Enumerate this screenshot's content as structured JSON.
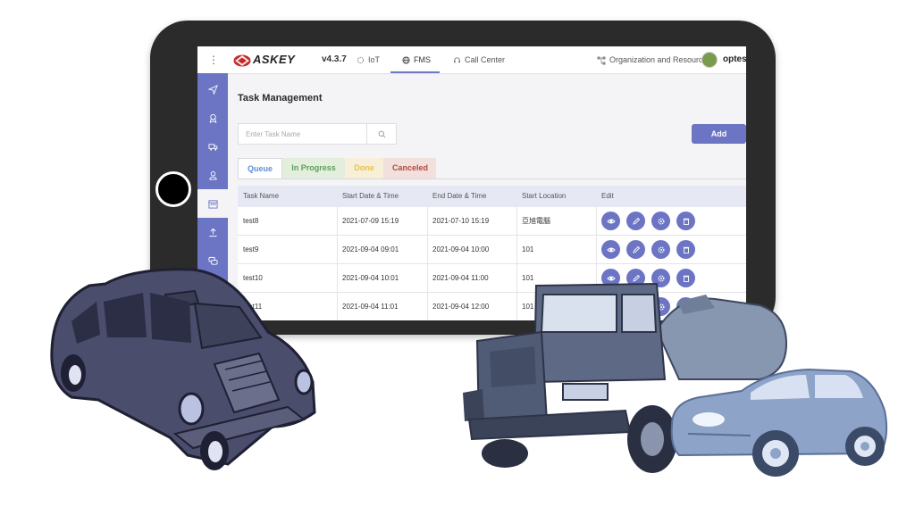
{
  "app": {
    "brand": "ASKEY",
    "version": "v4.3.7",
    "user": "optest"
  },
  "topnav": {
    "items": [
      {
        "label": "IoT",
        "icon": "iot-icon"
      },
      {
        "label": "FMS",
        "icon": "globe-icon",
        "active": true
      },
      {
        "label": "Call Center",
        "icon": "headset-icon"
      }
    ],
    "org_resource": "Organization and Resource"
  },
  "sidebar": {
    "items": [
      {
        "icon": "navigation-icon"
      },
      {
        "icon": "driver-badge-icon"
      },
      {
        "icon": "truck-icon"
      },
      {
        "icon": "user-icon"
      },
      {
        "icon": "calendar-icon",
        "active": true
      },
      {
        "icon": "upload-icon"
      },
      {
        "icon": "chat-icon"
      },
      {
        "icon": "person-icon"
      }
    ]
  },
  "page": {
    "title": "Task Management",
    "search_placeholder": "Enter Task Name",
    "add_label": "Add"
  },
  "tabs": [
    {
      "label": "Queue",
      "color": "#5b8fd6",
      "bg": "#ffffff"
    },
    {
      "label": "In Progress",
      "color": "#5f9e5a",
      "bg": "#e3eedd"
    },
    {
      "label": "Done",
      "color": "#e8c14a",
      "bg": "#f7efd8"
    },
    {
      "label": "Canceled",
      "color": "#b24a3e",
      "bg": "#f2e0dc"
    }
  ],
  "table": {
    "columns": [
      "Task Name",
      "Start Date & Time",
      "End Date & Time",
      "Start Location",
      "Edit"
    ],
    "rows": [
      [
        "test8",
        "2021-07-09 15:19",
        "2021-07-10 15:19",
        "亞旭電腦"
      ],
      [
        "test9",
        "2021-09-04 09:01",
        "2021-09-04 10:00",
        "101"
      ],
      [
        "test10",
        "2021-09-04 10:01",
        "2021-09-04 11:00",
        "101"
      ],
      [
        "test11",
        "2021-09-04 11:01",
        "2021-09-04 12:00",
        "101"
      ]
    ],
    "edit_icons": [
      "view-icon",
      "edit-pen-icon",
      "settings-icon",
      "delete-icon"
    ]
  },
  "colors": {
    "accent": "#6c74c4",
    "tablet": "#2b2b2b",
    "taxi": "#4a4d6b",
    "truck": "#5e6a85",
    "car": "#8ea3c8"
  }
}
